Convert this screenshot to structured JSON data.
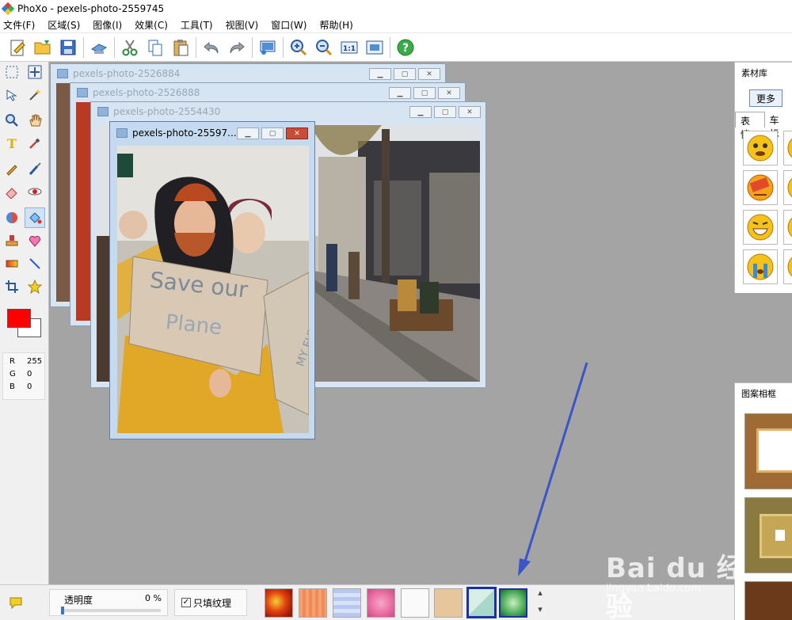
{
  "window": {
    "title": "PhoXo - pexels-photo-2559745"
  },
  "menu": [
    "文件(F)",
    "区域(S)",
    "图像(I)",
    "效果(C)",
    "工具(T)",
    "视图(V)",
    "窗口(W)",
    "帮助(H)"
  ],
  "toolbar": [
    {
      "name": "new-icon"
    },
    {
      "name": "open-folder-icon"
    },
    {
      "name": "save-icon"
    },
    {
      "name": "scanner-icon"
    },
    {
      "name": "cut-icon"
    },
    {
      "name": "copy-icon"
    },
    {
      "name": "paste-icon"
    },
    {
      "name": "undo-icon"
    },
    {
      "name": "redo-icon"
    },
    {
      "name": "screen-capture-icon"
    },
    {
      "name": "zoom-in-icon"
    },
    {
      "name": "zoom-out-icon"
    },
    {
      "name": "actual-size-icon"
    },
    {
      "name": "fit-window-icon"
    },
    {
      "name": "help-icon"
    }
  ],
  "colors": {
    "foreground": "#ff0000",
    "background": "#ffffff"
  },
  "rgb": [
    {
      "label": "R",
      "value": "255"
    },
    {
      "label": "G",
      "value": "0"
    },
    {
      "label": "B",
      "value": "0"
    }
  ],
  "documents": [
    {
      "title": "pexels-photo-2526884"
    },
    {
      "title": "pexels-photo-2526888"
    },
    {
      "title": "pexels-photo-2554430"
    },
    {
      "title": "pexels-photo-25597..."
    }
  ],
  "photo": {
    "sign_text_1": "Save our",
    "sign_text_2": "Plane",
    "sign_text_3": "MY FUTURE?"
  },
  "material_panel": {
    "title": "素材库",
    "more_label": "更多",
    "tabs": [
      "表情",
      "车标"
    ]
  },
  "frame_panel": {
    "title": "图案相框"
  },
  "bottom": {
    "opacity_label": "透明度",
    "opacity_value": "0 %",
    "opacity_fraction": 0,
    "texture_only_label": "只填纹理",
    "texture_only_checked": true
  },
  "watermark": {
    "text": "Bai du 经验",
    "sub": "jingyan.baidu.com"
  },
  "accent": {
    "selection": "#1c2fa8",
    "arrow": "#3a55c8"
  }
}
